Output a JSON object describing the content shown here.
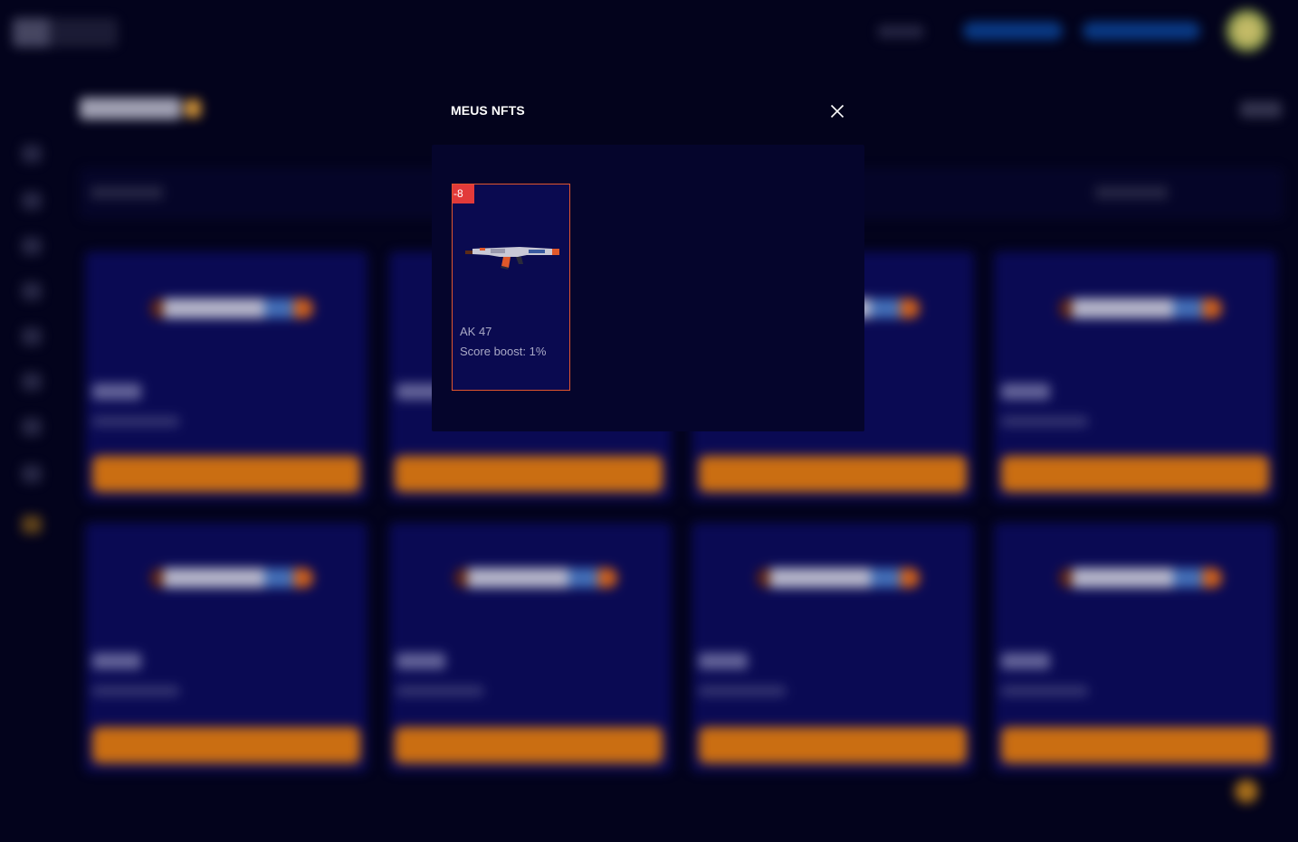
{
  "modal": {
    "title": "MEUS NFTS",
    "close_icon": "close-icon"
  },
  "nfts": [
    {
      "badge": "-8",
      "name": "AK 47",
      "boost": "Score boost: 1%",
      "icon": "rifle-icon"
    }
  ],
  "colors": {
    "background": "#03031c",
    "modal_body": "#05052c",
    "card_bg": "#0a0a50",
    "card_border": "#e0552e",
    "badge": "#e23a3a",
    "bg_button": "#e07a12"
  }
}
